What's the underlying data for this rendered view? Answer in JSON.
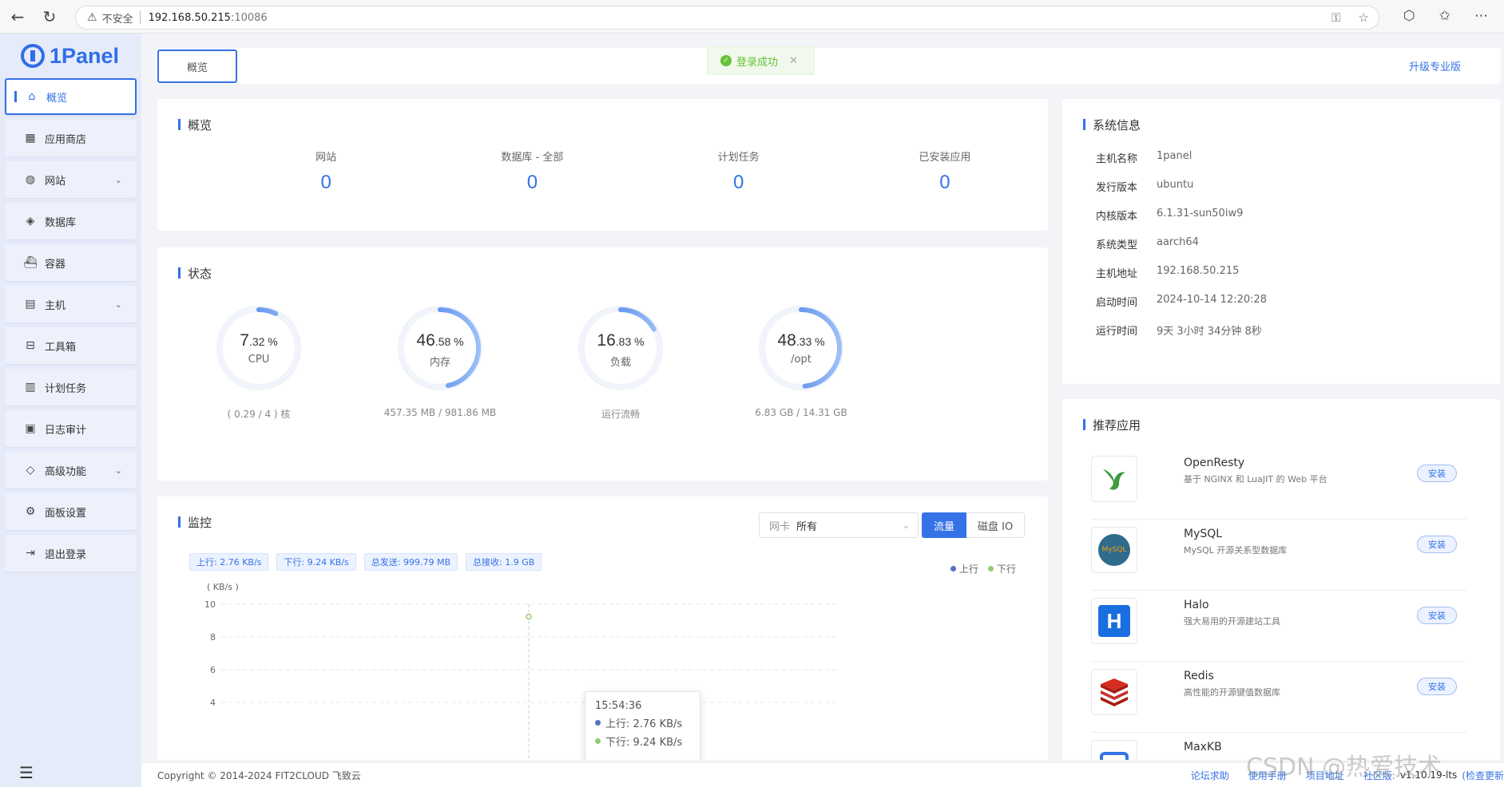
{
  "browser": {
    "security_label": "不安全",
    "host": "192.168.50.215",
    "port": ":10086"
  },
  "sidebar": {
    "logo": "1Panel",
    "items": [
      {
        "label": "概览",
        "icon": "home-icon",
        "active": true
      },
      {
        "label": "应用商店",
        "icon": "grid-icon"
      },
      {
        "label": "网站",
        "icon": "globe-icon",
        "expandable": true
      },
      {
        "label": "数据库",
        "icon": "layers-icon"
      },
      {
        "label": "容器",
        "icon": "whale-icon"
      },
      {
        "label": "主机",
        "icon": "server-icon",
        "expandable": true
      },
      {
        "label": "工具箱",
        "icon": "toolbox-icon"
      },
      {
        "label": "计划任务",
        "icon": "calendar-icon"
      },
      {
        "label": "日志审计",
        "icon": "log-icon"
      },
      {
        "label": "高级功能",
        "icon": "diamond-icon",
        "expandable": true
      },
      {
        "label": "面板设置",
        "icon": "gear-icon"
      },
      {
        "label": "退出登录",
        "icon": "logout-icon"
      }
    ]
  },
  "topbar": {
    "tab": "概览",
    "toast": "登录成功",
    "upgrade": "升级专业版"
  },
  "overview": {
    "title": "概览",
    "stats": [
      {
        "label": "网站",
        "value": "0"
      },
      {
        "label": "数据库 - 全部",
        "value": "0"
      },
      {
        "label": "计划任务",
        "value": "0"
      },
      {
        "label": "已安装应用",
        "value": "0"
      }
    ]
  },
  "status": {
    "title": "状态",
    "gauges": [
      {
        "int": "7",
        "dec": ".32 %",
        "percent": 7.32,
        "name": "CPU",
        "foot": "( 0.29 / 4 ) 核"
      },
      {
        "int": "46",
        "dec": ".58 %",
        "percent": 46.58,
        "name": "内存",
        "foot": "457.35 MB / 981.86 MB"
      },
      {
        "int": "16",
        "dec": ".83 %",
        "percent": 16.83,
        "name": "负载",
        "foot": "运行流畅"
      },
      {
        "int": "48",
        "dec": ".33 %",
        "percent": 48.33,
        "name": "/opt",
        "foot": "6.83 GB / 14.31 GB"
      }
    ]
  },
  "monitor": {
    "title": "监控",
    "netcard_label": "网卡",
    "netcard_value": "所有",
    "btn_traffic": "流量",
    "btn_disk": "磁盘 IO",
    "tags": [
      "上行: 2.76 KB/s",
      "下行: 9.24 KB/s",
      "总发送: 999.79 MB",
      "总接收: 1.9 GB"
    ],
    "legend_up": "上行",
    "legend_down": "下行",
    "colors": {
      "up": "#5470c6",
      "down": "#91cc75"
    },
    "tooltip": {
      "time": "15:54:36",
      "up": "上行:  2.76 KB/s",
      "down": "下行:  9.24 KB/s"
    }
  },
  "chart_data": {
    "type": "line",
    "ylabel": "( KB/s )",
    "yticks": [
      4,
      6,
      8,
      10
    ],
    "ylim": [
      4,
      10
    ],
    "x": [
      "15:54:36"
    ],
    "series": [
      {
        "name": "上行",
        "values": [
          2.76
        ]
      },
      {
        "name": "下行",
        "values": [
          9.24
        ]
      }
    ]
  },
  "sysinfo": {
    "title": "系统信息",
    "rows": [
      {
        "key": "主机名称",
        "value": "1panel"
      },
      {
        "key": "发行版本",
        "value": "ubuntu"
      },
      {
        "key": "内核版本",
        "value": "6.1.31-sun50iw9"
      },
      {
        "key": "系统类型",
        "value": "aarch64"
      },
      {
        "key": "主机地址",
        "value": "192.168.50.215"
      },
      {
        "key": "启动时间",
        "value": "2024-10-14 12:20:28"
      },
      {
        "key": "运行时间",
        "value": "9天 3小时 34分钟 8秒"
      }
    ]
  },
  "recommend": {
    "title": "推荐应用",
    "install_label": "安装",
    "apps": [
      {
        "name": "OpenResty",
        "desc": "基于 NGINX 和 LuaJIT 的 Web 平台",
        "icon": "openresty-icon"
      },
      {
        "name": "MySQL",
        "desc": "MySQL 开源关系型数据库",
        "icon": "mysql-icon",
        "badge": "MySQL"
      },
      {
        "name": "Halo",
        "desc": "强大易用的开源建站工具",
        "icon": "halo-icon",
        "badge": "H"
      },
      {
        "name": "Redis",
        "desc": "高性能的开源键值数据库",
        "icon": "redis-icon"
      },
      {
        "name": "MaxKB",
        "desc": "",
        "icon": "maxkb-icon"
      }
    ]
  },
  "footer": {
    "copyright": "Copyright © 2014-2024 FIT2CLOUD 飞致云",
    "links": [
      "论坛求助",
      "使用手册",
      "项目地址"
    ],
    "version_label": "社区版:",
    "version": "v1.10.19-lts",
    "check_update": "(检查更新"
  },
  "watermark": "CSDN @热爱技术"
}
